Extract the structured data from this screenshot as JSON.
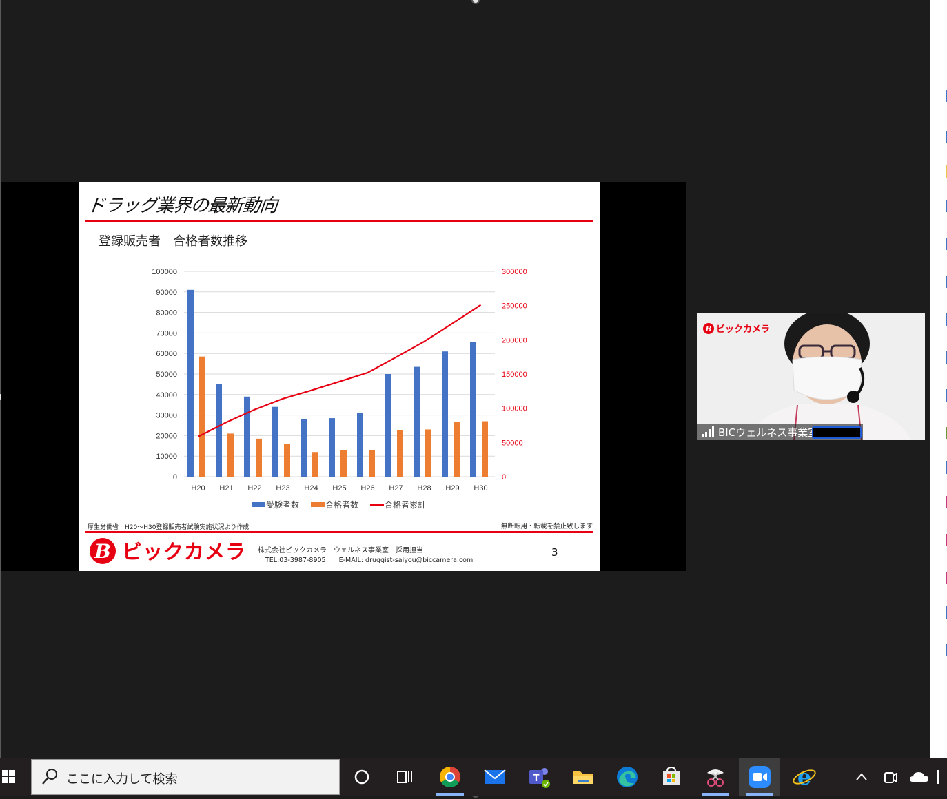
{
  "slide": {
    "title": "ドラッグ業界の最新動向",
    "subtitle": "登録販売者　合格者数推移",
    "source_note": "厚生労働省　H20～H30登録販売者試験実施状況より作成",
    "copyright_note": "無断転用・転載を禁止致します",
    "footer_company": "株式会社ビックカメラ　ウェルネス事業室　採用担当",
    "footer_contact": "TEL:03-3987-8905　　E-MAIL: druggist-saiyou@biccamera.com",
    "page_number": "3",
    "logo_text": "ビックカメラ",
    "brand_color": "#e60012"
  },
  "chart_data": {
    "type": "bar",
    "categories": [
      "H20",
      "H21",
      "H22",
      "H23",
      "H24",
      "H25",
      "H26",
      "H27",
      "H28",
      "H29",
      "H30"
    ],
    "series": [
      {
        "name": "受験者数",
        "kind": "bar",
        "axis": "left",
        "color": "#4472c4",
        "values": [
          91000,
          45000,
          39000,
          34000,
          28000,
          28500,
          31000,
          50000,
          53500,
          61000,
          65500
        ]
      },
      {
        "name": "合格者数",
        "kind": "bar",
        "axis": "left",
        "color": "#ed7d31",
        "values": [
          58500,
          21000,
          18500,
          16000,
          12000,
          13000,
          13000,
          22500,
          23000,
          26500,
          27000
        ]
      },
      {
        "name": "合格者累計",
        "kind": "line",
        "axis": "right",
        "color": "#e60012",
        "values": [
          58500,
          79500,
          98000,
          114000,
          126000,
          139000,
          152000,
          174500,
          197500,
          224000,
          251000
        ]
      }
    ],
    "y_left": {
      "min": 0,
      "max": 100000,
      "ticks": [
        "0",
        "10000",
        "20000",
        "30000",
        "40000",
        "50000",
        "60000",
        "70000",
        "80000",
        "90000",
        "100000"
      ]
    },
    "y_right": {
      "min": 0,
      "max": 300000,
      "ticks": [
        "0",
        "50000",
        "100000",
        "150000",
        "200000",
        "250000",
        "300000"
      ]
    },
    "legend_position": "bottom",
    "grid": true
  },
  "participant": {
    "name": "BICウェルネス事業室",
    "logo_text": "ビックカメラ"
  },
  "taskbar": {
    "search_placeholder": "ここに入力して検索",
    "apps": [
      "cortana-icon",
      "task-view-icon",
      "chrome-icon",
      "mail-icon",
      "teams-icon",
      "file-explorer-icon",
      "edge-icon",
      "store-icon",
      "snip-icon",
      "zoom-icon",
      "internet-explorer-icon"
    ]
  }
}
